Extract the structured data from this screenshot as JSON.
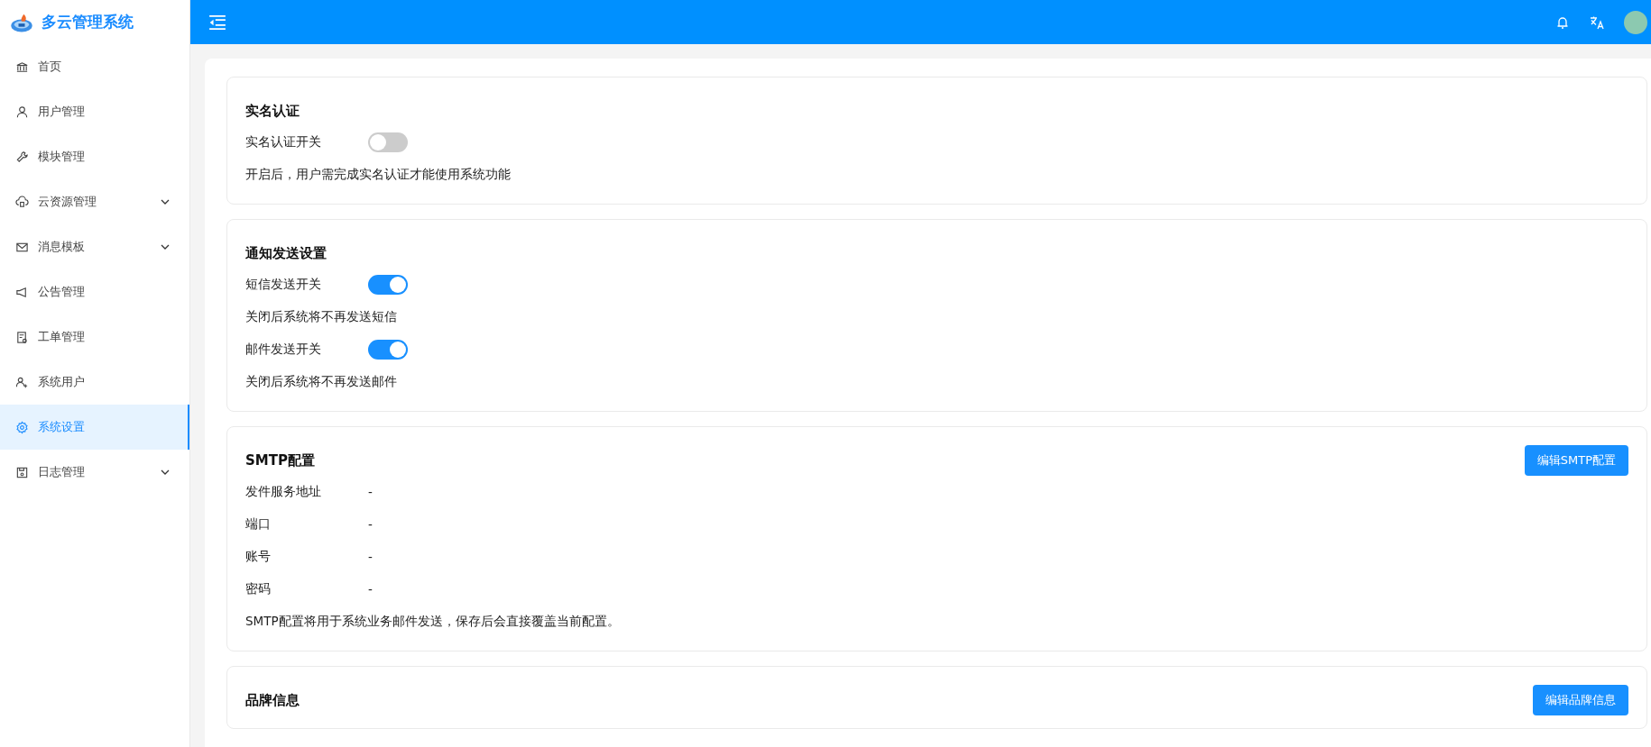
{
  "app": {
    "title": "多云管理系统"
  },
  "sidebar": {
    "items": [
      {
        "label": "首页",
        "selected": false,
        "expandable": false
      },
      {
        "label": "用户管理",
        "selected": false,
        "expandable": false
      },
      {
        "label": "模块管理",
        "selected": false,
        "expandable": false
      },
      {
        "label": "云资源管理",
        "selected": false,
        "expandable": true
      },
      {
        "label": "消息模板",
        "selected": false,
        "expandable": true
      },
      {
        "label": "公告管理",
        "selected": false,
        "expandable": false
      },
      {
        "label": "工单管理",
        "selected": false,
        "expandable": false
      },
      {
        "label": "系统用户",
        "selected": false,
        "expandable": false
      },
      {
        "label": "系统设置",
        "selected": true,
        "expandable": false
      },
      {
        "label": "日志管理",
        "selected": false,
        "expandable": true
      }
    ]
  },
  "sections": [
    {
      "title": "实名认证",
      "rows": [
        {
          "kind": "toggle",
          "label": "实名认证开关",
          "on": false
        },
        {
          "kind": "note",
          "text": "开启后，用户需完成实名认证才能使用系统功能"
        }
      ]
    },
    {
      "title": "通知发送设置",
      "rows": [
        {
          "kind": "toggle",
          "label": "短信发送开关",
          "on": true
        },
        {
          "kind": "note",
          "text": "关闭后系统将不再发送短信"
        },
        {
          "kind": "toggle",
          "label": "邮件发送开关",
          "on": true
        },
        {
          "kind": "note",
          "text": "关闭后系统将不再发送邮件"
        }
      ]
    },
    {
      "title": "SMTP配置",
      "button": "编辑SMTP配置",
      "rows": [
        {
          "kind": "field",
          "label": "发件服务地址",
          "value": "-"
        },
        {
          "kind": "field",
          "label": "端口",
          "value": "-"
        },
        {
          "kind": "field",
          "label": "账号",
          "value": "-"
        },
        {
          "kind": "field",
          "label": "密码",
          "value": "-"
        },
        {
          "kind": "note",
          "text": "SMTP配置将用于系统业务邮件发送，保存后会直接覆盖当前配置。"
        }
      ]
    },
    {
      "title": "品牌信息",
      "button": "编辑品牌信息"
    }
  ]
}
